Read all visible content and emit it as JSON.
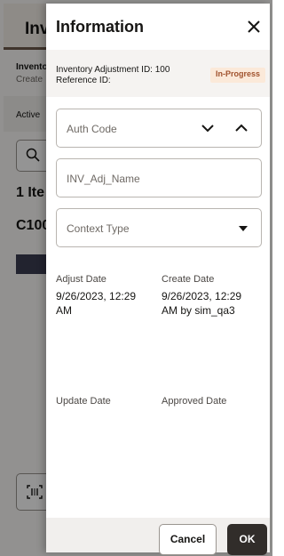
{
  "background": {
    "title": "Inv",
    "subtitle": "Invento",
    "subtitle2": "Create",
    "filter_text": "Active",
    "item_count": "1 Ite",
    "item_id": "C100"
  },
  "drawer": {
    "title": "Information",
    "info": {
      "adjustment_id": "Inventory Adjustment ID: 100",
      "reference_id": "Reference ID:",
      "status": "In-Progress"
    },
    "fields": {
      "auth_code": "Auth Code",
      "name_placeholder": "INV_Adj_Name",
      "context_type": "Context Type"
    },
    "dates": {
      "adjust_label": "Adjust Date",
      "adjust_value": "9/26/2023, 12:29 AM",
      "create_label": "Create Date",
      "create_value": "9/26/2023, 12:29 AM by sim_qa3",
      "update_label": "Update Date",
      "approved_label": "Approved Date"
    },
    "footer": {
      "cancel": "Cancel",
      "ok": "OK"
    }
  },
  "colors": {
    "status_bg": "#fbe9d9",
    "status_text": "#a0522d",
    "primary_button": "#312d2a"
  }
}
